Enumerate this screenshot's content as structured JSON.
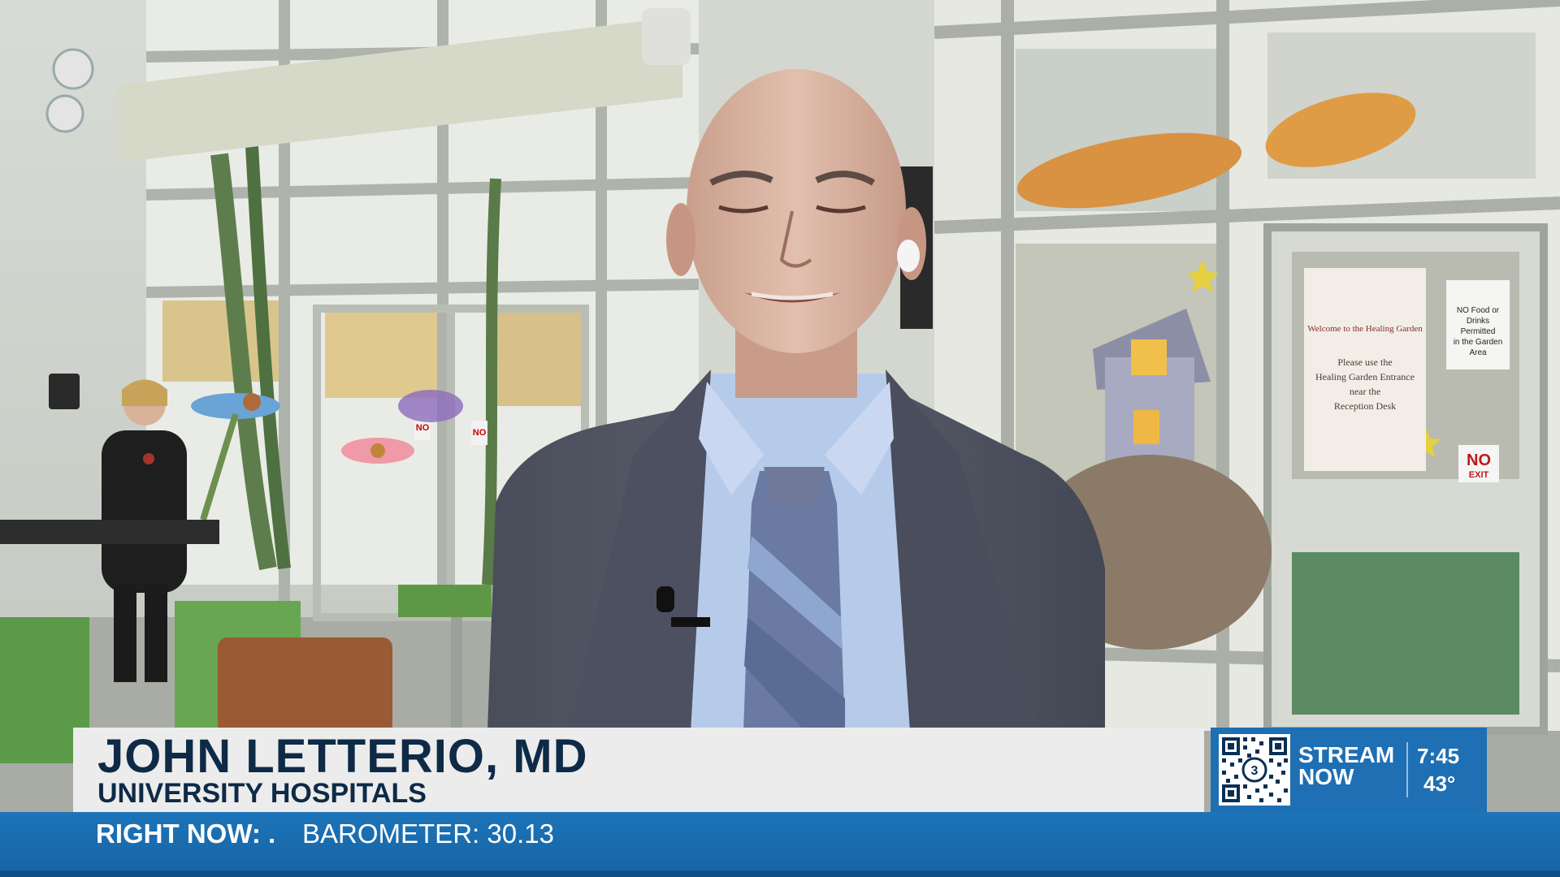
{
  "lower_third": {
    "name": "JOHN LETTERIO, MD",
    "affiliation": "UNIVERSITY HOSPITALS"
  },
  "stream_promo": {
    "qr_badge": "3",
    "label_line1": "STREAM",
    "label_line2": "NOW",
    "time": "7:45",
    "temperature": "43°"
  },
  "ticker": {
    "label": "RIGHT NOW: .",
    "text": "BAROMETER: 30.13"
  },
  "scene_signs": {
    "no_sign_left_1": "NO",
    "no_sign_left_2": "NO",
    "no_exit_line1": "NO",
    "no_exit_line2": "EXIT",
    "notice_line1": "NO Food or",
    "notice_line2": "Drinks",
    "notice_line3": "Permitted",
    "notice_line4": "in the Garden",
    "notice_line5": "Area",
    "welcome_title": "Welcome to the Healing Garden",
    "welcome_line1": "Please use the",
    "welcome_line2": "Healing Garden Entrance",
    "welcome_line3": "near the",
    "welcome_line4": "Reception Desk"
  },
  "colors": {
    "name_text": "#0e2a47",
    "lower_third_bg": "#ececec",
    "stream_bg": "#1e6fb3",
    "ticker_bg": "#1d74b8"
  },
  "icons": [
    "qr-code-icon",
    "station-logo-icon"
  ]
}
